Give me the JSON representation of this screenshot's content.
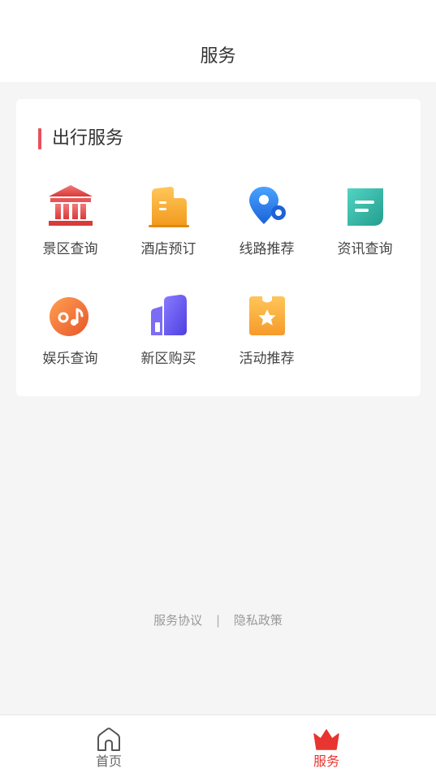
{
  "header": {
    "title": "服务"
  },
  "section": {
    "title": "出行服务"
  },
  "services": [
    {
      "label": "景区查询",
      "icon": "museum-icon",
      "color": "#e55656"
    },
    {
      "label": "酒店预订",
      "icon": "hotel-building-icon",
      "color": "#f5a623"
    },
    {
      "label": "线路推荐",
      "icon": "route-pin-icon",
      "color": "#2a7df0"
    },
    {
      "label": "资讯查询",
      "icon": "news-doc-icon",
      "color": "#32b8a8"
    },
    {
      "label": "娱乐查询",
      "icon": "music-disc-icon",
      "color": "#f07a3c"
    },
    {
      "label": "新区购买",
      "icon": "buildings-icon",
      "color": "#6a5af0"
    },
    {
      "label": "活动推荐",
      "icon": "star-ticket-icon",
      "color": "#f7a93a"
    }
  ],
  "footer": {
    "terms": "服务协议",
    "separator": "|",
    "privacy": "隐私政策"
  },
  "tabbar": {
    "home": {
      "label": "首页",
      "icon": "home-icon"
    },
    "service": {
      "label": "服务",
      "icon": "crown-icon",
      "active": true
    }
  },
  "colors": {
    "accent": "#e8352f",
    "section_bar": "#e8505b"
  }
}
